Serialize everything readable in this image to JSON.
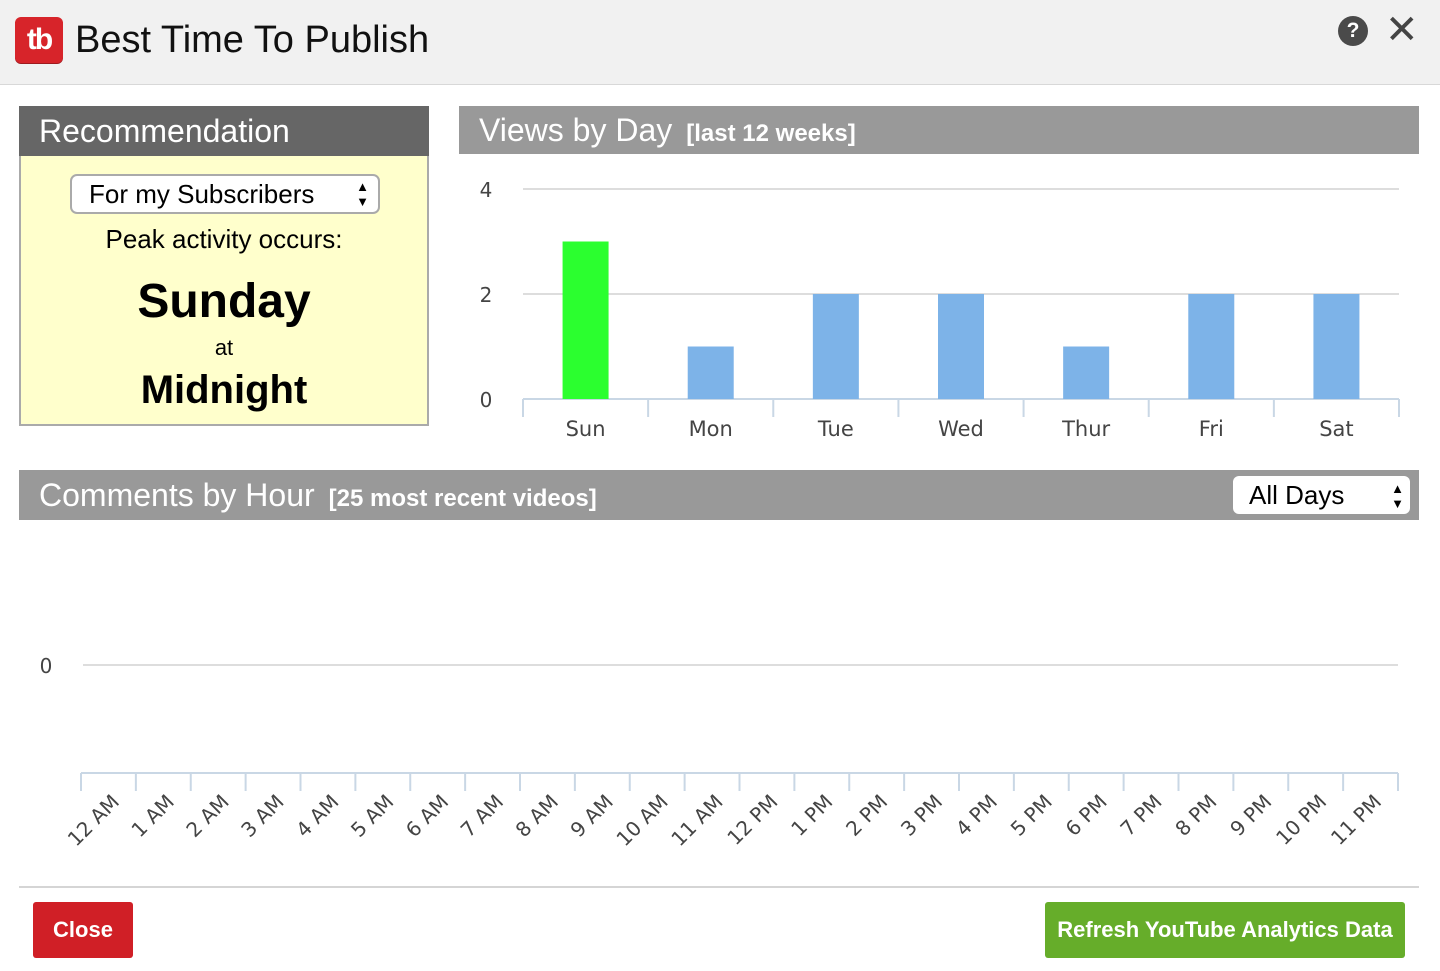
{
  "header": {
    "logo_text": "tb",
    "title": "Best Time To Publish",
    "help_glyph": "?",
    "close_glyph": "✕"
  },
  "recommendation": {
    "title": "Recommendation",
    "audience_selected": "For my Subscribers",
    "peak_label": "Peak activity occurs:",
    "peak_day": "Sunday",
    "at_label": "at",
    "peak_time": "Midnight"
  },
  "views": {
    "title": "Views by Day",
    "subtitle": "[last 12 weeks]"
  },
  "comments": {
    "title": "Comments by Hour",
    "subtitle": "[25 most recent videos]",
    "filter_selected": "All Days"
  },
  "footer": {
    "close_label": "Close",
    "refresh_label": "Refresh YouTube Analytics Data"
  },
  "colors": {
    "highlight_bar": "#2bff2f",
    "normal_bar": "#7db3e8",
    "close_button": "#d01f26",
    "refresh_button": "#66ad2a",
    "rec_body": "#ffffcc"
  },
  "chart_data": [
    {
      "type": "bar",
      "categories": [
        "Sun",
        "Mon",
        "Tue",
        "Wed",
        "Thur",
        "Fri",
        "Sat"
      ],
      "values": [
        3,
        1,
        2,
        2,
        1,
        2,
        2
      ],
      "highlight_index": 0,
      "ylim": [
        0,
        4
      ],
      "yticks": [
        0,
        2,
        4
      ],
      "grid": true
    },
    {
      "type": "bar",
      "categories": [
        "12 AM",
        "1 AM",
        "2 AM",
        "3 AM",
        "4 AM",
        "5 AM",
        "6 AM",
        "7 AM",
        "8 AM",
        "9 AM",
        "10 AM",
        "11 AM",
        "12 PM",
        "1 PM",
        "2 PM",
        "3 PM",
        "4 PM",
        "5 PM",
        "6 PM",
        "7 PM",
        "8 PM",
        "9 PM",
        "10 PM",
        "11 PM"
      ],
      "values": [
        0,
        0,
        0,
        0,
        0,
        0,
        0,
        0,
        0,
        0,
        0,
        0,
        0,
        0,
        0,
        0,
        0,
        0,
        0,
        0,
        0,
        0,
        0,
        0
      ],
      "yticks": [
        0
      ],
      "grid": true
    }
  ]
}
